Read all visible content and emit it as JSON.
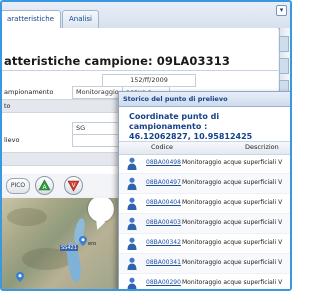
{
  "tabs": [
    {
      "label": "aratteristiche"
    },
    {
      "label": "Analisi"
    }
  ],
  "header": {
    "title": "atteristiche campione: 09LA03313"
  },
  "fields": {
    "date_value": "152/ff/2009",
    "row1_label": "ampionamento",
    "row1_value": "Monitoraggio",
    "row1_value2": "acque s",
    "row2_label": "to",
    "row3_value": "SG",
    "row4_label": "lievo"
  },
  "nav": {
    "print_label": "PICO",
    "up_icon": "arrow-up-icon",
    "down_icon": "arrow-down-icon"
  },
  "map": {
    "road_label": "SS421",
    "town_label": "ero"
  },
  "popup": {
    "title": "Storico del punto di prelievo",
    "coord_line1": "Coordinate punto di campionamento :",
    "coord_line2": "46.12062827, 10.95812425",
    "col_code": "Codice",
    "col_desc": "Descrizion",
    "rows": [
      {
        "code": "08BA00498",
        "desc": "Monitoraggio acque superficiali V"
      },
      {
        "code": "08BA00497",
        "desc": "Monitoraggio acque superficiali V"
      },
      {
        "code": "08BA00404",
        "desc": "Monitoraggio acque superficiali V"
      },
      {
        "code": "08BA00403",
        "desc": "Monitoraggio acque superficiali V"
      },
      {
        "code": "08BA00342",
        "desc": "Monitoraggio acque superficiali V"
      },
      {
        "code": "08BA00341",
        "desc": "Monitoraggio acque superficiali V"
      },
      {
        "code": "08BA00290",
        "desc": "Monitoraggio acque superficiali V"
      }
    ]
  },
  "colors": {
    "accent": "#15428b",
    "frame": "#3a97e0"
  }
}
